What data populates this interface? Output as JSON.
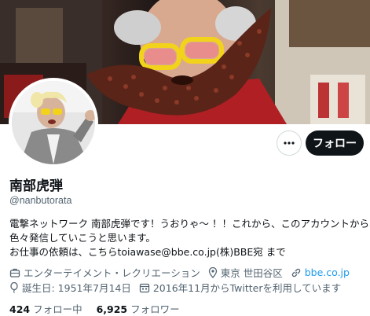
{
  "profile": {
    "name": "南部虎弾",
    "handle": "@nanbutorata",
    "bio_lines": [
      "電撃ネットワーク 南部虎弾です！うおりゃ〜 ！！これから、このアカウントから、",
      "色々発信していこうと思います。",
      "お仕事の依頼は、こちらtoiawase@bbe.co.jp(株)BBE宛 まで"
    ],
    "category": "エンターテイメント・レクリエーション",
    "location": "東京 世田谷区",
    "website": "bbe.co.jp",
    "birthday": "誕生日: 1951年7月14日",
    "joined": "2016年11月からTwitterを利用しています"
  },
  "actions": {
    "follow_label": "フォロー",
    "more_label": "···"
  },
  "stats": {
    "following_count": "424",
    "following_label": "フォロー中",
    "followers_count": "6,925",
    "followers_label": "フォロワー"
  },
  "colors": {
    "link": "#1d9bf0",
    "secondary_text": "#536471",
    "primary_text": "#0f1419",
    "follow_button_bg": "#0f1419"
  },
  "icons": [
    "more-icon",
    "briefcase-icon",
    "location-icon",
    "link-icon",
    "balloon-icon",
    "calendar-icon"
  ]
}
